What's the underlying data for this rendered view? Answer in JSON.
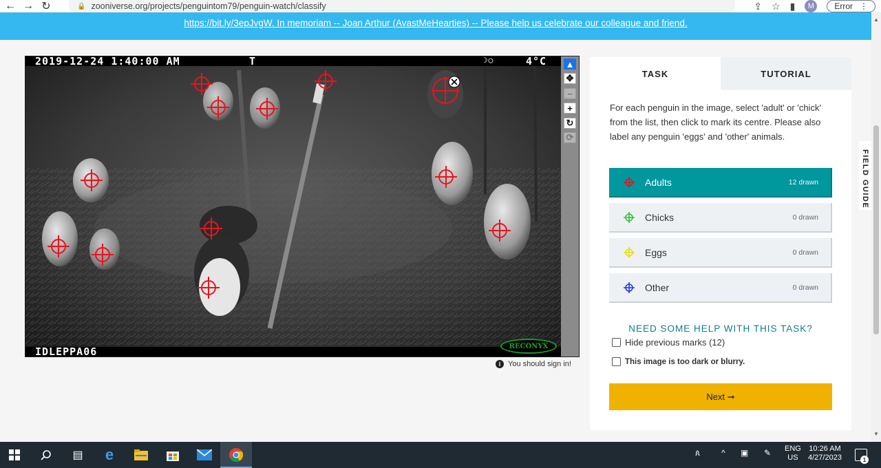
{
  "browser": {
    "url": "zooniverse.org/projects/penguintom79/penguin-watch/classify",
    "back_icon": "arrow-left-icon",
    "forward_icon": "arrow-right-icon",
    "reload_icon": "reload-icon",
    "avatar_letter": "M",
    "error_label": "Error"
  },
  "banner": {
    "link_text": "https://bit.ly/3epJvgW",
    "separator": ". ",
    "memoriam_text": "In memoriam -- Joan Arthur (AvastMeHearties) -- Please help us celebrate our colleague and friend",
    "end": "."
  },
  "camera": {
    "timestamp": "2019-12-24 1:40:00 AM",
    "marker": "T",
    "moon": "☽◯",
    "temperature": "4°C",
    "camera_id": "IDLEPPA06",
    "brand": "RECONYX"
  },
  "viewer": {
    "sign_in_notice": "You should sign in!",
    "marks_color": "#e8141e"
  },
  "task": {
    "tab_task": "TASK",
    "tab_tutorial": "TUTORIAL",
    "instructions": "For each penguin in the image, select 'adult' or 'chick' from the list, then click to mark its centre. Please also label any penguin 'eggs' and 'other' animals.",
    "tools": [
      {
        "label": "Adults",
        "count": "12 drawn",
        "color": "#e8141e"
      },
      {
        "label": "Chicks",
        "count": "0 drawn",
        "color": "#2fc23a"
      },
      {
        "label": "Eggs",
        "count": "0 drawn",
        "color": "#e6e200"
      },
      {
        "label": "Other",
        "count": "0 drawn",
        "color": "#2437e0"
      }
    ],
    "help_link": "NEED SOME HELP WITH THIS TASK?",
    "hide_marks": "Hide previous marks (12)",
    "too_dark": "This image is too dark or blurry.",
    "next_label": "Next ➞",
    "field_guide": "FIELD GUIDE",
    "accent": "#00979d",
    "next_color": "#f0b200"
  },
  "taskbar": {
    "language_top": "ENG",
    "language_bottom": "US",
    "time": "10:26 AM",
    "date": "4/27/2023",
    "notifications": "1"
  }
}
